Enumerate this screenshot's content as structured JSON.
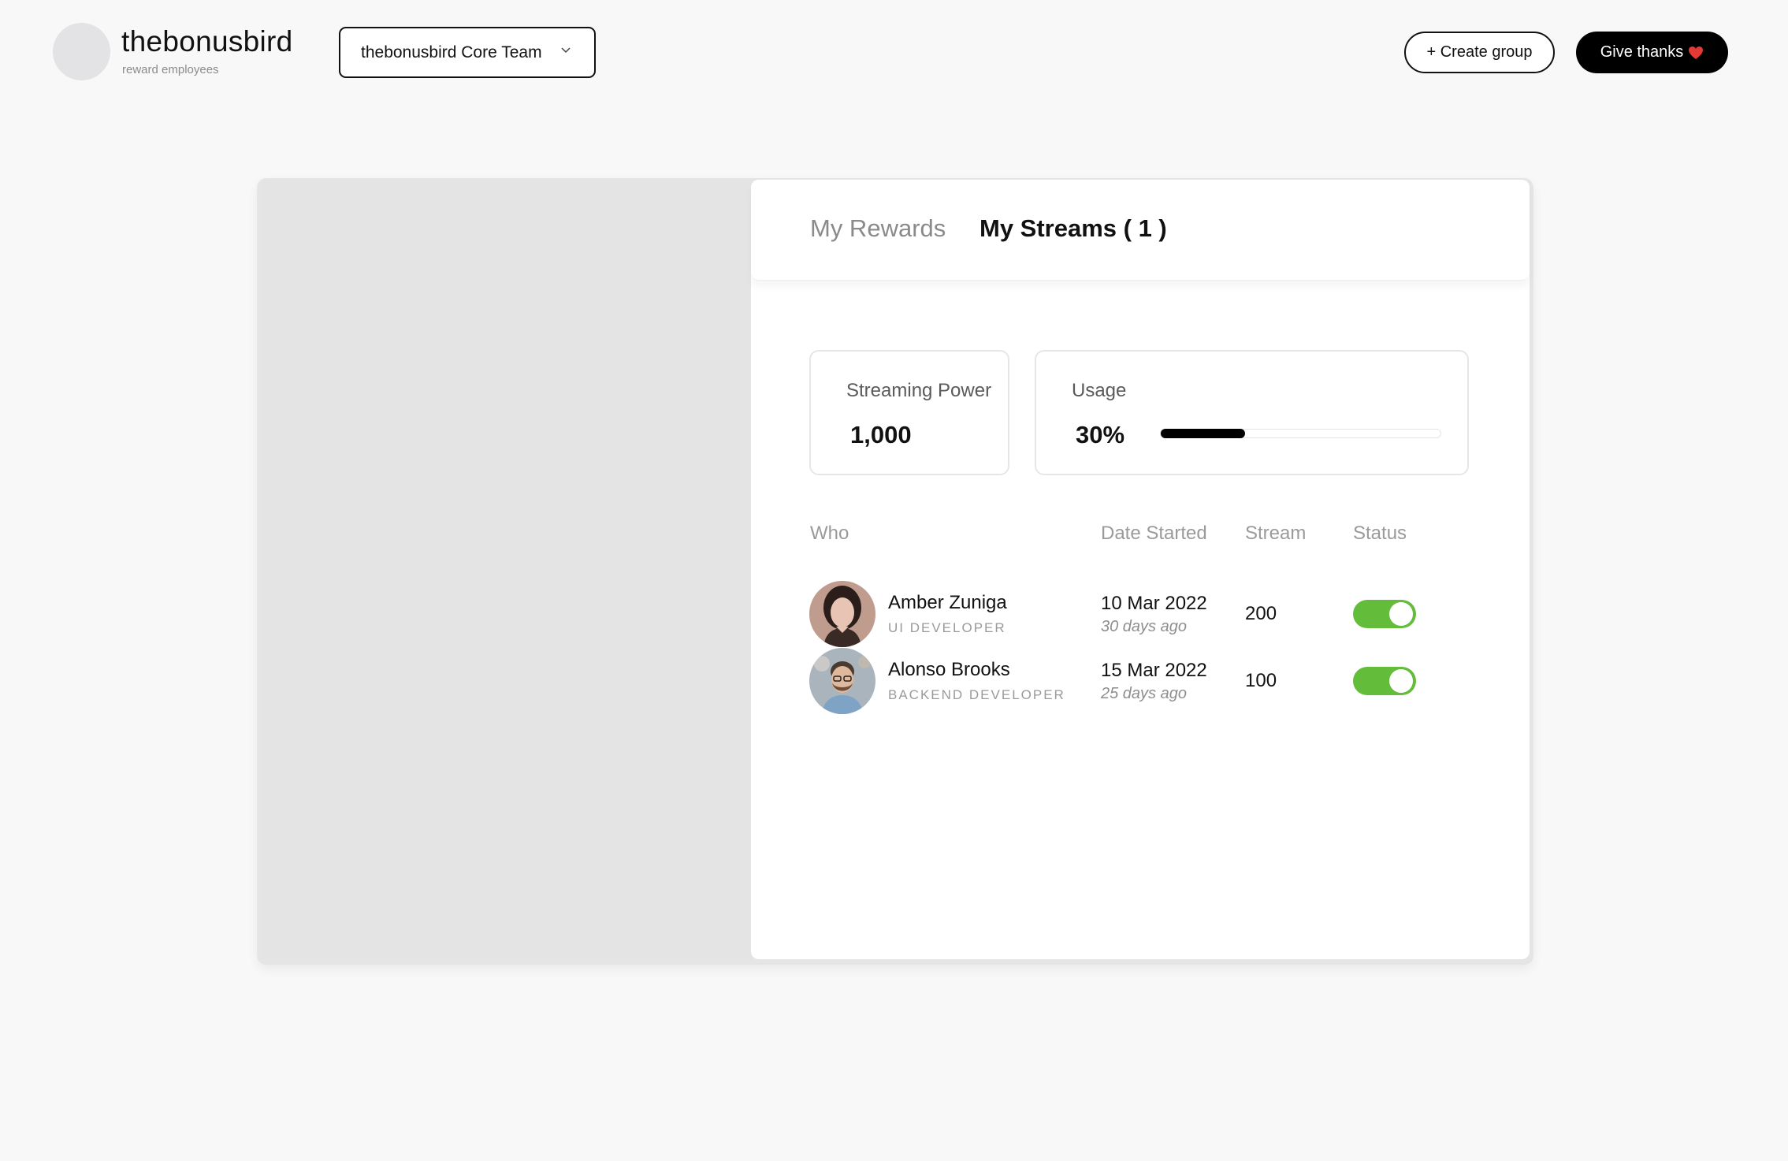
{
  "brand": {
    "name": "thebonusbird",
    "tagline": "reward employees"
  },
  "header": {
    "team_select": "thebonusbird Core Team",
    "create_group": "+ Create group",
    "give_thanks": "Give thanks"
  },
  "tabs": [
    {
      "label": "My Rewards",
      "active": false
    },
    {
      "label": "My Streams ( 1 )",
      "active": true
    }
  ],
  "stats": {
    "power_label": "Streaming Power",
    "power_value": "1,000",
    "usage_label": "Usage",
    "usage_value": "30%",
    "usage_fraction": 0.3
  },
  "table": {
    "headers": {
      "who": "Who",
      "date": "Date Started",
      "stream": "Stream",
      "status": "Status"
    },
    "rows": [
      {
        "name": "Amber Zuniga",
        "role": "UI DEVELOPER",
        "date": "10 Mar 2022",
        "ago": "30 days ago",
        "stream": "200",
        "status_on": true
      },
      {
        "name": "Alonso Brooks",
        "role": "BACKEND DEVELOPER",
        "date": "15 Mar 2022",
        "ago": "25 days ago",
        "stream": "100",
        "status_on": true
      }
    ]
  },
  "colors": {
    "accent_green": "#64bc3b",
    "heart": "#e53935",
    "dark": "#000000"
  },
  "icons": {
    "team_select": "chevron-down-icon",
    "give_thanks": "heart-icon"
  }
}
